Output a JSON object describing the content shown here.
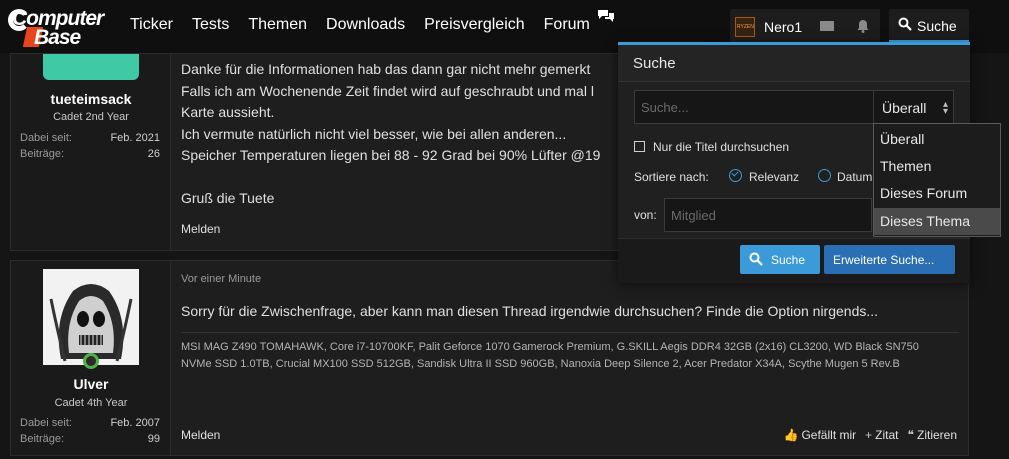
{
  "header": {
    "logo_line1": "Computer",
    "logo_line2": "Base",
    "nav": [
      "Ticker",
      "Tests",
      "Themen",
      "Downloads",
      "Preisvergleich",
      "Forum"
    ],
    "avatar_text": "RYZEN",
    "username": "Nero1",
    "search_label": "Suche"
  },
  "posts": [
    {
      "user": "tueteimsack",
      "rank": "Cadet 2nd Year",
      "joined_label": "Dabei seit:",
      "joined": "Feb. 2021",
      "posts_label": "Beiträge:",
      "posts": "26",
      "lines": [
        "Danke für die Informationen hab das dann gar nicht mehr gemerkt",
        "Falls ich am Wochenende Zeit findet wird auf geschraubt und mal l",
        "Karte aussieht.",
        "Ich vermute natürlich nicht viel besser, wie bei allen anderen...",
        "Speicher Temperaturen liegen bei 88 - 92 Grad bei 90% Lüfter @19",
        "",
        "Gruß die Tuete"
      ],
      "report": "Melden"
    },
    {
      "user": "Ulver",
      "rank": "Cadet 4th Year",
      "joined_label": "Dabei seit:",
      "joined": "Feb. 2007",
      "posts_label": "Beiträge:",
      "posts": "99",
      "time": "Vor einer Minute",
      "text": "Sorry für die Zwischenfrage, aber kann man diesen Thread irgendwie durchsuchen? Finde die Option nirgends...",
      "sig_line1": "MSI MAG Z490 TOMAHAWK, Core i7-10700KF, Palit Geforce 1070 Gamerock Premium, G.SKILL Aegis DDR4 32GB (2x16) CL3200, WD Black SN750",
      "sig_line2": "NVMe SSD 1.0TB, Crucial MX100 SSD 512GB, Sandisk Ultra II SSD 960GB, Nanoxia Deep Silence 2, Acer Predator X34A, Scythe Mugen 5 Rev.B",
      "report": "Melden",
      "like": "Gefällt mir",
      "quote": "Zitat",
      "cite": "Zitieren"
    }
  ],
  "search_popup": {
    "title": "Suche",
    "placeholder": "Suche...",
    "scope_selected": "Überall",
    "title_only_label": "Nur die Titel durchsuchen",
    "sort_label": "Sortiere nach:",
    "sort_options": [
      "Relevanz",
      "Datum"
    ],
    "from_label": "von:",
    "member_placeholder": "Mitglied",
    "search_button": "Suche",
    "advanced_button": "Erweiterte Suche..."
  },
  "scope_options": [
    "Überall",
    "Themen",
    "Dieses Forum",
    "Dieses Thema"
  ],
  "colors": {
    "accent": "#3c9ad8",
    "online": "#4db348",
    "teal": "#3fc9a5"
  }
}
